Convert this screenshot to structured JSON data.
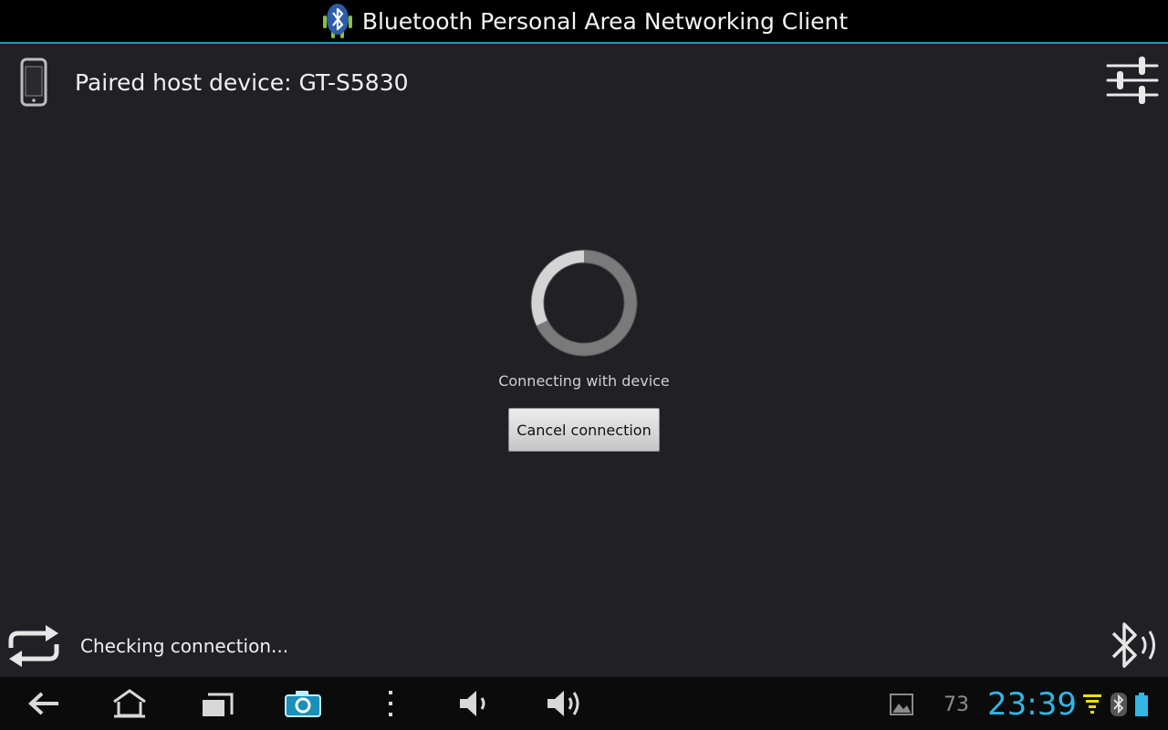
{
  "titlebar": {
    "title": "Bluetooth Personal Area Networking Client",
    "icon": "bluetooth-android-app-icon"
  },
  "host": {
    "label": "Paired host device: GT-S5830",
    "icon": "phone-icon"
  },
  "settings": {
    "icon": "sliders-settings-icon"
  },
  "connecting": {
    "status": "Connecting with device",
    "cancel_label": "Cancel connection",
    "icon": "loading-spinner"
  },
  "footer": {
    "status": "Checking connection...",
    "sync_icon": "sync-icon",
    "bluetooth_icon": "bluetooth-signal-icon"
  },
  "navbar": {
    "buttons": [
      "back-icon",
      "home-icon",
      "recent-apps-icon",
      "screenshot-camera-icon",
      "menu-icon",
      "volume-down-icon",
      "volume-up-icon"
    ],
    "notification_count": "73",
    "clock": "23:39"
  },
  "colors": {
    "accent": "#33b5e5",
    "background": "#212125",
    "titlebar": "#000000"
  }
}
